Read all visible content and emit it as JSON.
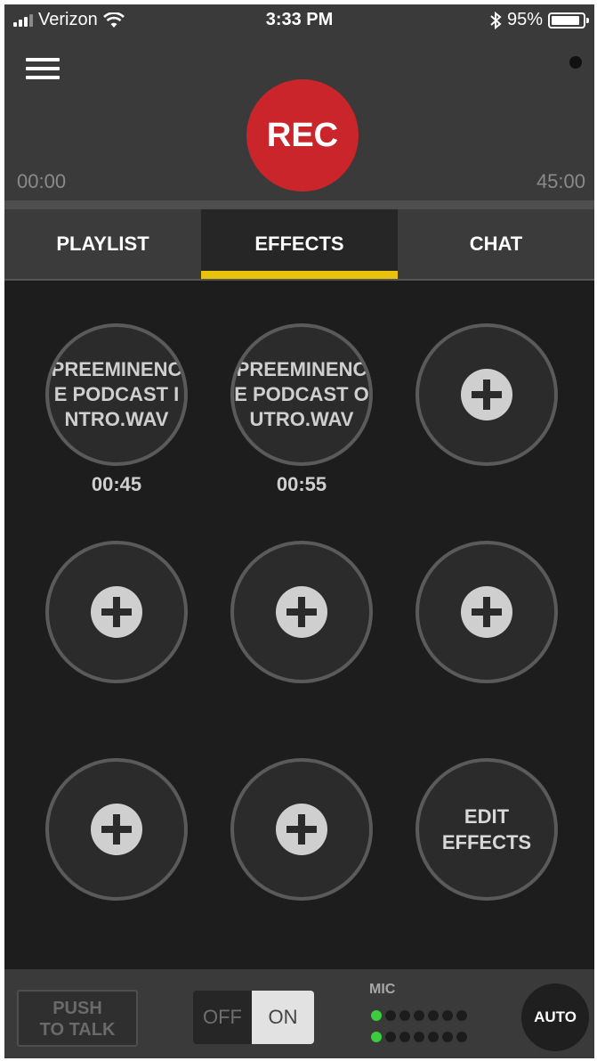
{
  "status_bar": {
    "carrier": "Verizon",
    "time": "3:33 PM",
    "battery": "95%",
    "battery_level": 0.95
  },
  "header": {
    "rec_label": "REC",
    "elapsed": "00:00",
    "limit": "45:00"
  },
  "tabs": [
    {
      "label": "PLAYLIST",
      "active": false
    },
    {
      "label": "EFFECTS",
      "active": true
    },
    {
      "label": "CHAT",
      "active": false
    }
  ],
  "effects": {
    "slots": [
      {
        "name": "PREEMINENCE PODCAST INTRO.WAV",
        "duration": "00:45"
      },
      {
        "name": "PREEMINENCE PODCAST OUTRO.WAV",
        "duration": "00:55"
      }
    ],
    "edit_label_line1": "EDIT",
    "edit_label_line2": "EFFECTS"
  },
  "bottom_bar": {
    "push_to_talk_line1": "PUSH",
    "push_to_talk_line2": "TO TALK",
    "toggle_off": "OFF",
    "toggle_on": "ON",
    "toggle_state": "ON",
    "mic_label": "MIC",
    "mic_level_left": 1,
    "mic_level_right": 1,
    "mic_meter_segments": 7,
    "auto_label": "AUTO"
  },
  "colors": {
    "rec": "#c9252b",
    "active_tab_underline": "#e8c20c",
    "meter_on": "#3ccd3c"
  }
}
